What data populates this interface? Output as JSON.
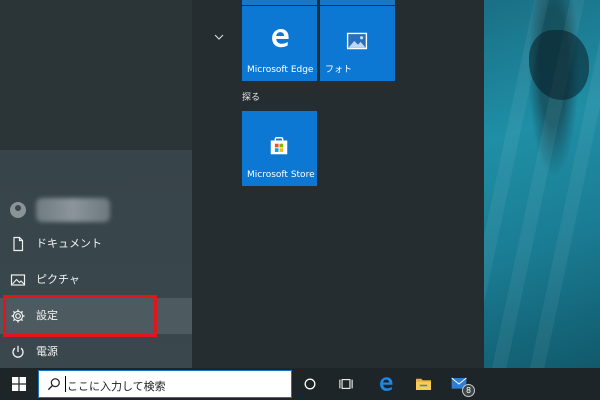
{
  "start_menu": {
    "rail": {
      "documents_label": "ドキュメント",
      "pictures_label": "ピクチャ",
      "settings_label": "設定",
      "power_label": "電源"
    },
    "group_label": "探る",
    "tiles": {
      "edge_label": "Microsoft Edge",
      "photos_label": "フォト",
      "store_label": "Microsoft Store"
    }
  },
  "taskbar": {
    "search_placeholder": "ここに入力して検索",
    "mail_badge_count": "8"
  },
  "colors": {
    "tile_blue": "#0d78d3",
    "highlight_red": "#e4141c",
    "edge_blue": "#1d88e5"
  },
  "icons": [
    "user-avatar",
    "document-icon",
    "picture-icon",
    "gear-icon",
    "power-icon",
    "chevron-up-icon",
    "edge-icon",
    "photos-icon",
    "store-icon",
    "windows-logo-icon",
    "search-icon",
    "cortana-icon",
    "task-view-icon",
    "folder-icon",
    "mail-icon"
  ]
}
